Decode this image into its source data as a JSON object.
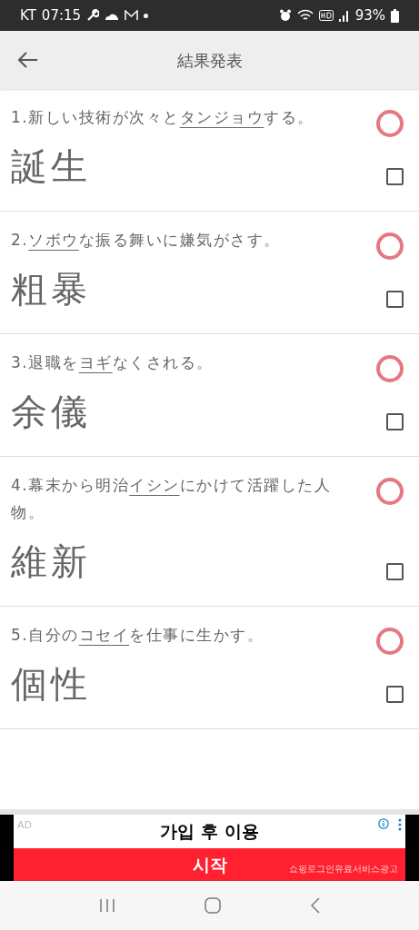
{
  "status_bar": {
    "carrier": "KT",
    "time": "07:15",
    "battery": "93%"
  },
  "header": {
    "title": "結果発表"
  },
  "questions": [
    {
      "number": "1.",
      "before": "新しい技術が次々と",
      "target": "タンジョウ",
      "after": "する。",
      "answer": "誕生",
      "kind": "circle",
      "checked": false
    },
    {
      "number": "2.",
      "target": "ソボウ",
      "after": "な振る舞いに嫌気がさす。",
      "answer": "粗暴",
      "kind": "circle",
      "checked": false
    },
    {
      "number": "3.",
      "before": "退職を",
      "target": "ヨギ",
      "after": "なくされる。",
      "answer": "余儀",
      "kind": "circle",
      "checked": false
    },
    {
      "number": "4.",
      "before": "幕末から明治",
      "target": "イシン",
      "after": "にかけて活躍した人物。",
      "answer": "維新",
      "kind": "circle",
      "checked": false
    },
    {
      "number": "5.",
      "before": "自分の",
      "target": "コセイ",
      "after": "を仕事に生かす。",
      "answer": "個性",
      "kind": "circle",
      "checked": false
    }
  ],
  "ad": {
    "label": "AD",
    "headline": "가입 후 이용",
    "cta": "시작",
    "disclaimer": "쇼핑로그인유료서비스광고"
  }
}
